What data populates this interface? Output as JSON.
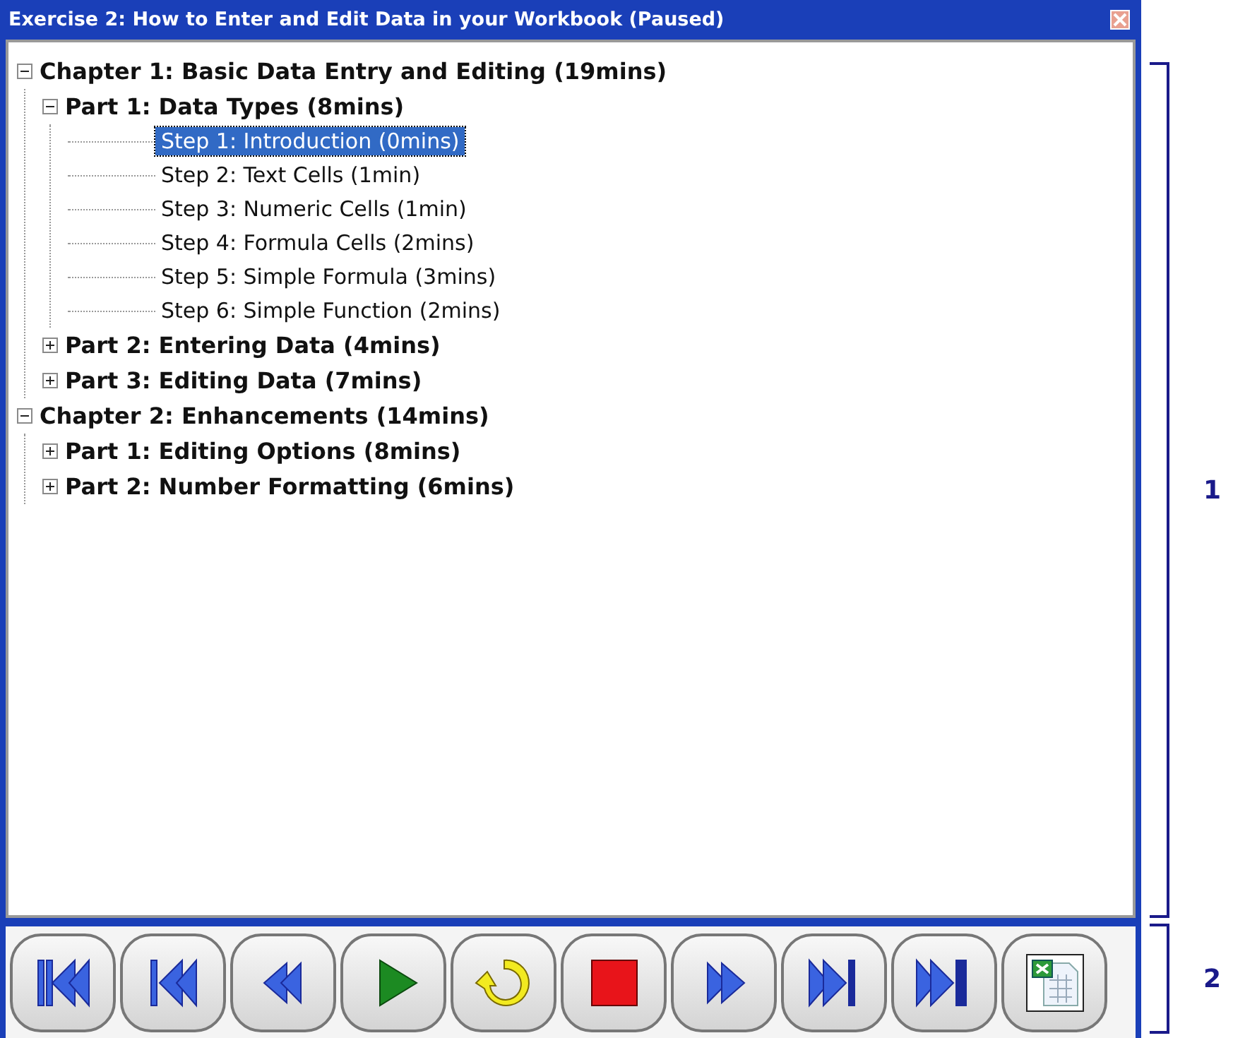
{
  "window": {
    "title": "Exercise 2:  How to Enter and Edit Data in your Workbook  (Paused)"
  },
  "tree": [
    {
      "label": "Chapter 1:  Basic Data Entry and Editing (19mins)",
      "expanded": true,
      "children": [
        {
          "label": "Part 1:  Data Types (8mins)",
          "expanded": true,
          "children": [
            {
              "label": "Step 1: Introduction (0mins)",
              "selected": true
            },
            {
              "label": "Step 2: Text Cells (1min)",
              "selected": false
            },
            {
              "label": "Step 3: Numeric Cells (1min)",
              "selected": false
            },
            {
              "label": "Step 4: Formula Cells (2mins)",
              "selected": false
            },
            {
              "label": "Step 5: Simple Formula (3mins)",
              "selected": false
            },
            {
              "label": "Step 6: Simple Function (2mins)",
              "selected": false
            }
          ]
        },
        {
          "label": "Part 2:  Entering Data (4mins)",
          "expanded": false
        },
        {
          "label": "Part 3:  Editing Data (7mins)",
          "expanded": false
        }
      ]
    },
    {
      "label": "Chapter 2:  Enhancements (14mins)",
      "expanded": true,
      "children": [
        {
          "label": "Part 1:  Editing Options (8mins)",
          "expanded": false
        },
        {
          "label": "Part 2:  Number Formatting (6mins)",
          "expanded": false
        }
      ]
    }
  ],
  "toolbar": [
    {
      "kind": "first"
    },
    {
      "kind": "previous-part"
    },
    {
      "kind": "back"
    },
    {
      "kind": "play"
    },
    {
      "kind": "replay"
    },
    {
      "kind": "stop"
    },
    {
      "kind": "forward"
    },
    {
      "kind": "next-part"
    },
    {
      "kind": "last"
    },
    {
      "kind": "excel"
    }
  ],
  "callouts": [
    "1",
    "2"
  ]
}
